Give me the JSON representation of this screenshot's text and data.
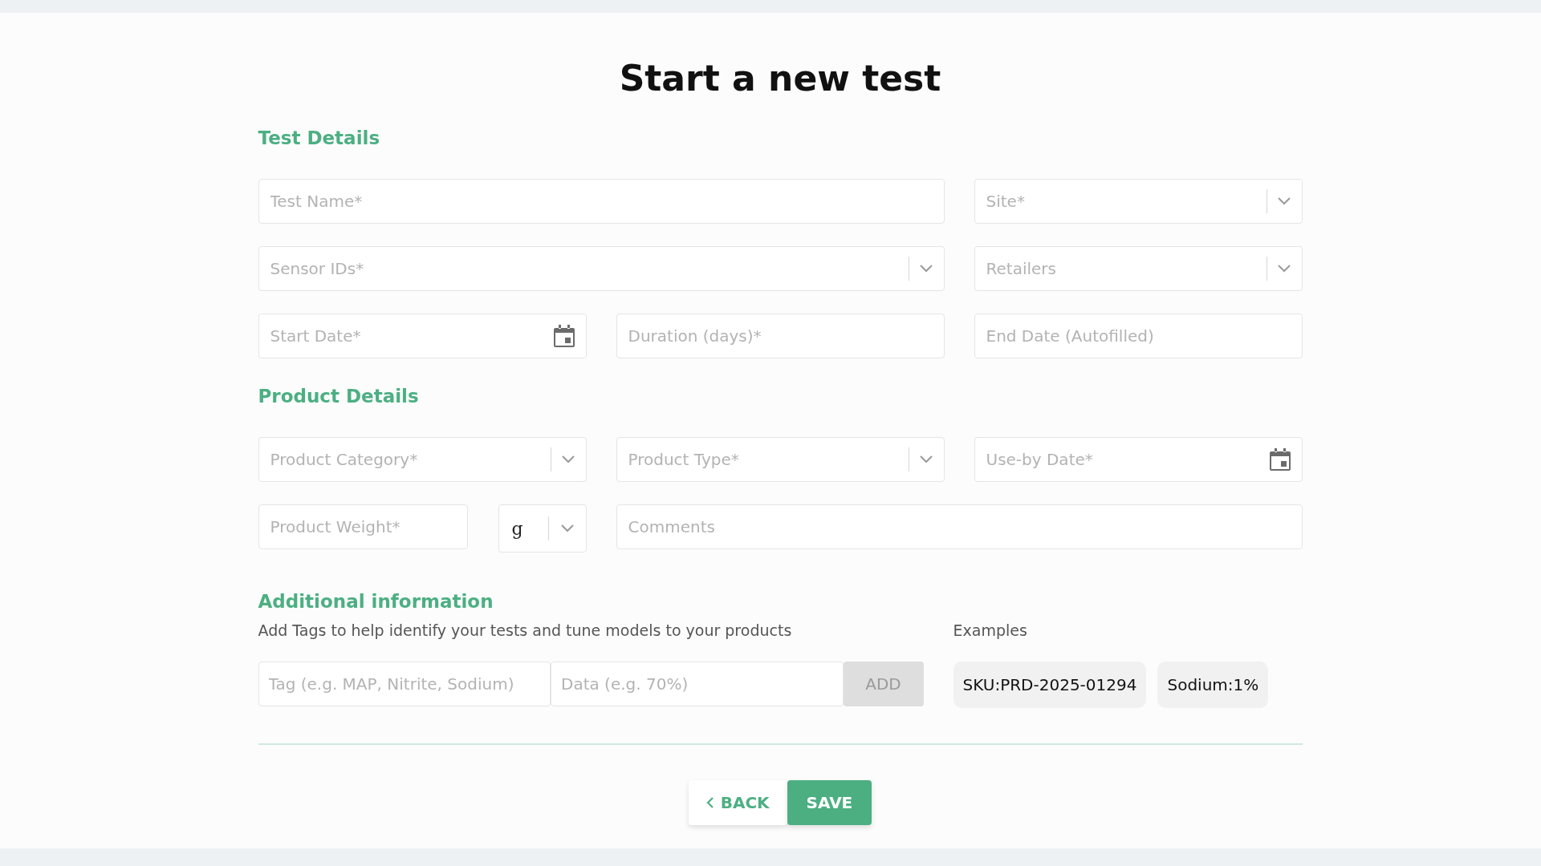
{
  "title": "Start a new test",
  "sections": [
    {
      "heading": "Test Details",
      "rows": [
        [
          {
            "kind": "text",
            "placeholder": "Test Name*"
          },
          {
            "kind": "select",
            "placeholder": "Site*"
          }
        ],
        [
          {
            "kind": "select",
            "placeholder": "Sensor IDs*"
          },
          {
            "kind": "select",
            "placeholder": "Retailers"
          }
        ],
        [
          {
            "kind": "date",
            "placeholder": "Start Date*"
          },
          {
            "kind": "text",
            "placeholder": "Duration (days)*"
          },
          {
            "kind": "text",
            "placeholder": "End Date (Autofilled)"
          }
        ]
      ]
    },
    {
      "heading": "Product Details",
      "rows": [
        [
          {
            "kind": "select",
            "placeholder": "Product Category*"
          },
          {
            "kind": "select",
            "placeholder": "Product Type*"
          },
          {
            "kind": "date",
            "placeholder": "Use-by Date*"
          }
        ],
        [
          {
            "kind": "text",
            "placeholder": "Product Weight*",
            "unit": {
              "value": "g"
            }
          },
          {
            "kind": "text",
            "placeholder": "Comments"
          }
        ]
      ]
    }
  ],
  "additional": {
    "heading": "Additional information",
    "description": "Add Tags to help identify your tests and tune models to your products",
    "tag_placeholder": "Tag (e.g. MAP, Nitrite, Sodium)",
    "data_placeholder": "Data (e.g. 70%)",
    "add_button": {
      "label": "ADD",
      "disabled": true
    },
    "examples_label": "Examples",
    "examples": [
      "SKU:PRD-2025-01294",
      "Sodium:1%"
    ]
  },
  "buttons": {
    "back": "BACK",
    "save": "SAVE"
  }
}
